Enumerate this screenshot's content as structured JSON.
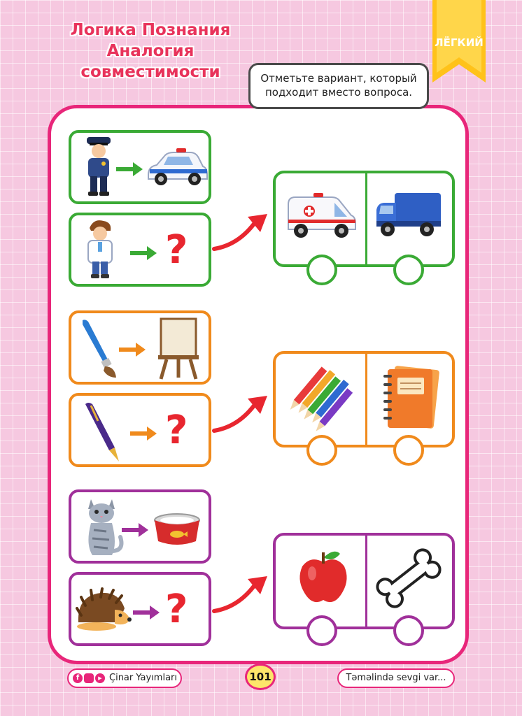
{
  "header": {
    "title_lines": [
      "Логика Познания",
      "Аналогия",
      "совместимости"
    ],
    "level_badge": "ЛЁГКИЙ"
  },
  "instruction": {
    "line1": "Отметьте вариант, который",
    "line2": "подходит вместо вопроса."
  },
  "tasks": [
    {
      "color": "#3aaa35",
      "example": {
        "left_icon": "policeman-icon",
        "right_icon": "police-car-icon"
      },
      "question": {
        "left_icon": "doctor-icon",
        "mark": "?"
      },
      "options": [
        {
          "icon": "ambulance-icon"
        },
        {
          "icon": "blue-truck-icon"
        }
      ]
    },
    {
      "color": "#f08a1c",
      "example": {
        "left_icon": "paintbrush-icon",
        "right_icon": "easel-icon"
      },
      "question": {
        "left_icon": "pen-icon",
        "mark": "?"
      },
      "options": [
        {
          "icon": "colored-pencils-icon"
        },
        {
          "icon": "notebook-icon"
        }
      ]
    },
    {
      "color": "#a0309a",
      "example": {
        "left_icon": "cat-icon",
        "right_icon": "cat-bowl-icon"
      },
      "question": {
        "left_icon": "hedgehog-icon",
        "mark": "?"
      },
      "options": [
        {
          "icon": "apple-icon"
        },
        {
          "icon": "bone-icon"
        }
      ]
    }
  ],
  "footer": {
    "publisher": "Çinar Yayımları",
    "page_number": "101",
    "slogan": "Təməlində sevgi var..."
  },
  "colors": {
    "accent_pink": "#e8267a",
    "title_red": "#e8335b",
    "ribbon_yellow": "#ffc21a"
  }
}
